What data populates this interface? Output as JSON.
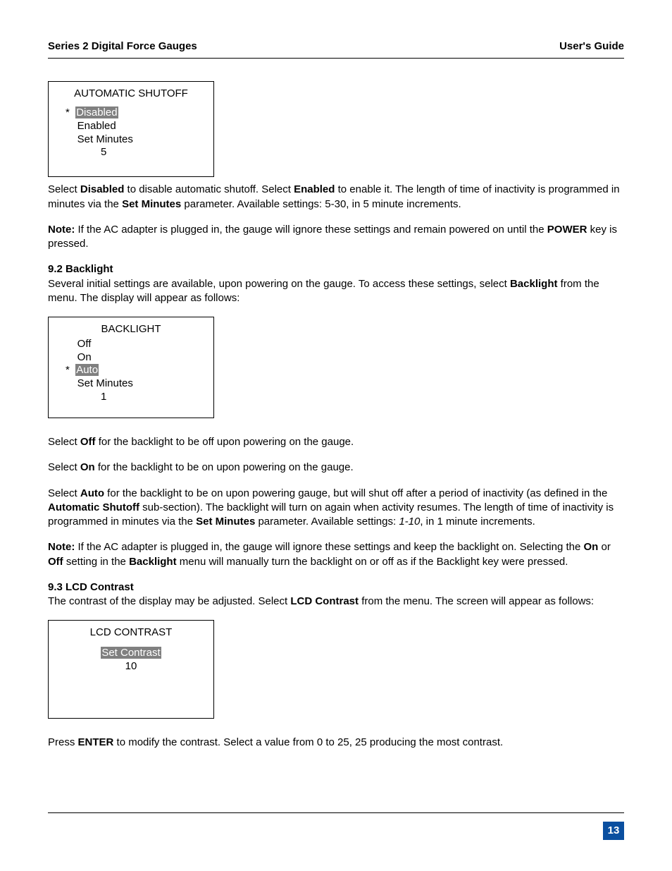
{
  "header": {
    "left": "Series 2 Digital Force Gauges",
    "right": "User's Guide"
  },
  "lcd1": {
    "title": "AUTOMATIC SHUTOFF",
    "star": "*  ",
    "indent": "    ",
    "indent2": "            ",
    "opt_disabled": "Disabled",
    "opt_enabled": "Enabled",
    "opt_setmin": "Set Minutes",
    "val": "5"
  },
  "p1a": "Select ",
  "p1_disabled": "Disabled",
  "p1b": " to disable automatic shutoff. Select ",
  "p1_enabled": "Enabled",
  "p1c": " to enable it. The length of time of inactivity is programmed in minutes via the ",
  "p1_setmin": "Set Minutes",
  "p1d": " parameter. Available settings: 5-30, in 5 minute increments.",
  "p2_note": "Note:",
  "p2a": " If the AC adapter is plugged in, the gauge will ignore these settings and remain powered on until the ",
  "p2_power": "POWER",
  "p2b": " key is pressed.",
  "s92_head": "9.2 Backlight",
  "s92_text_a": "Several initial settings are available, upon powering on the gauge. To access these settings, select ",
  "s92_backlight": "Backlight",
  "s92_text_b": " from the menu. The display will appear as follows:",
  "lcd2": {
    "title": "BACKLIGHT",
    "indent": "    ",
    "star": "*  ",
    "indent2": "            ",
    "opt_off": "Off",
    "opt_on": "On",
    "opt_auto": "Auto",
    "opt_setmin": "Set Minutes",
    "val": "1"
  },
  "p3a": "Select ",
  "p3_off": "Off",
  "p3b": " for the backlight to be off upon powering on the gauge.",
  "p4a": "Select ",
  "p4_on": "On",
  "p4b": " for the backlight to be on upon powering on the gauge.",
  "p5a": "Select ",
  "p5_auto": "Auto",
  "p5b": " for the backlight to be on upon powering gauge, but will shut off after a period of inactivity (as defined in the ",
  "p5_autoshutoff": "Automatic Shutoff",
  "p5c": " sub-section). The backlight will turn on again when activity resumes. The length of time of inactivity is programmed in minutes via the ",
  "p5_setmin": "Set Minutes",
  "p5d": " parameter. Available settings: ",
  "p5_range": "1-10",
  "p5e": ", in 1 minute increments.",
  "p6_note": "Note:",
  "p6a": " If the AC adapter is plugged in, the gauge will ignore these settings and keep the backlight on. Selecting the ",
  "p6_on": "On",
  "p6b": " or ",
  "p6_off": "Off",
  "p6c": " setting in the ",
  "p6_backlight": "Backlight",
  "p6d": " menu will manually turn the backlight on or off as if the Backlight key were pressed.",
  "s93_head": "9.3 LCD Contrast",
  "s93_a": "The contrast of the display may be adjusted. Select ",
  "s93_lcd": "LCD Contrast",
  "s93_b": " from the menu. The screen will appear as follows:",
  "lcd3": {
    "title": "LCD CONTRAST",
    "indent": "    ",
    "indent2": "           ",
    "opt_setcontrast": "Set Contrast",
    "val": "10"
  },
  "p7a": "Press ",
  "p7_enter": "ENTER",
  "p7b": " to modify the contrast. Select a value from 0 to 25, 25 producing the most contrast.",
  "page_number": "13"
}
